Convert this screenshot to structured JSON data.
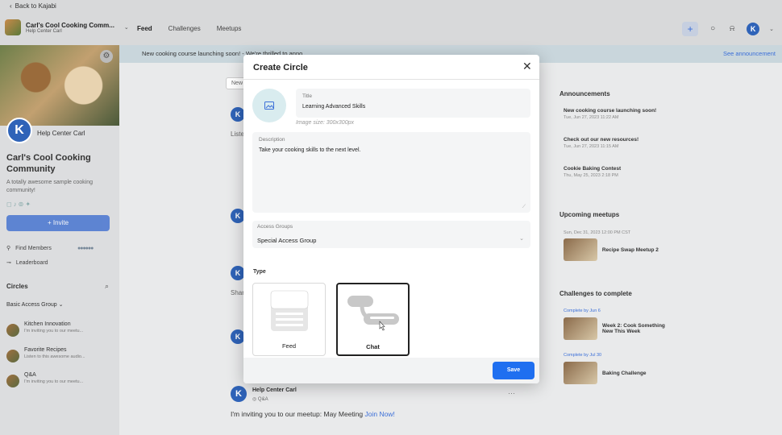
{
  "topbar": {
    "back_label": "Back to Kajabi",
    "community_name": "Carl's Cool Cooking Comm...",
    "community_sub": "Help Center Carl",
    "tabs": [
      {
        "label": "Feed",
        "active": true
      },
      {
        "label": "Challenges",
        "active": false
      },
      {
        "label": "Meetups",
        "active": false
      }
    ],
    "avatar_letter": "K"
  },
  "banner": {
    "text": "New cooking course launching soon! - We're thrilled to anno...",
    "link": "See announcement"
  },
  "sidebar": {
    "host_name": "Help Center Carl",
    "host_letter": "K",
    "community_title": "Carl's Cool Cooking Community",
    "description": "A totally awesome sample cooking community!",
    "invite_label": "Invite",
    "find_members": "Find Members",
    "leaderboard": "Leaderboard",
    "circles_heading": "Circles",
    "group_select": "Basic Access Group",
    "circles": [
      {
        "name": "Kitchen Innovation",
        "sub": "I'm inviting you to our meetu..."
      },
      {
        "name": "Favorite Recipes",
        "sub": "Listen to this awesome audio..."
      },
      {
        "name": "Q&A",
        "sub": "I'm inviting you to our meetu..."
      }
    ]
  },
  "center_stubs": {
    "new_btn": "New",
    "listen": "Listen",
    "share": "Share"
  },
  "right_panel": {
    "announcements_heading": "Announcements",
    "announcements": [
      {
        "title": "New cooking course launching soon!",
        "date": "Tue, Jun 27, 2023 11:22 AM"
      },
      {
        "title": "Check out our new resources!",
        "date": "Tue, Jun 27, 2023 11:15 AM"
      },
      {
        "title": "Cookie Baking Contest",
        "date": "Thu, May 25, 2023 2:18 PM"
      }
    ],
    "meetups_heading": "Upcoming meetups",
    "meetup_date": "Sun, Dec 31, 2023 12:00 PM CST",
    "meetup_title": "Recipe Swap Meetup 2",
    "challenges_heading": "Challenges to complete",
    "challenges": [
      {
        "due": "Complete by Jun 6",
        "title": "Week 2: Cook Something New This Week"
      },
      {
        "due": "Complete by Jul 30",
        "title": "Baking Challenge"
      }
    ]
  },
  "modal": {
    "title": "Create Circle",
    "title_field_label": "Title",
    "title_field_value": "Learning Advanced Skills",
    "image_size": "Image size: 300x300px",
    "description_label": "Description",
    "description_value": "Take your cooking skills to the next level.",
    "access_groups_label": "Access Groups",
    "access_groups_value": "Special Access Group",
    "type_label": "Type",
    "type_feed": "Feed",
    "type_chat": "Chat",
    "selected_type": "Chat",
    "save_label": "Save"
  },
  "post": {
    "author": "Help Center Carl",
    "circle": "Q&A",
    "body": "I'm inviting you to our meetup: May Meeting",
    "link": "Join Now!",
    "avatar_letter": "K"
  },
  "colors": {
    "accent": "#1f6ff0",
    "brand": "#2f63b8"
  }
}
